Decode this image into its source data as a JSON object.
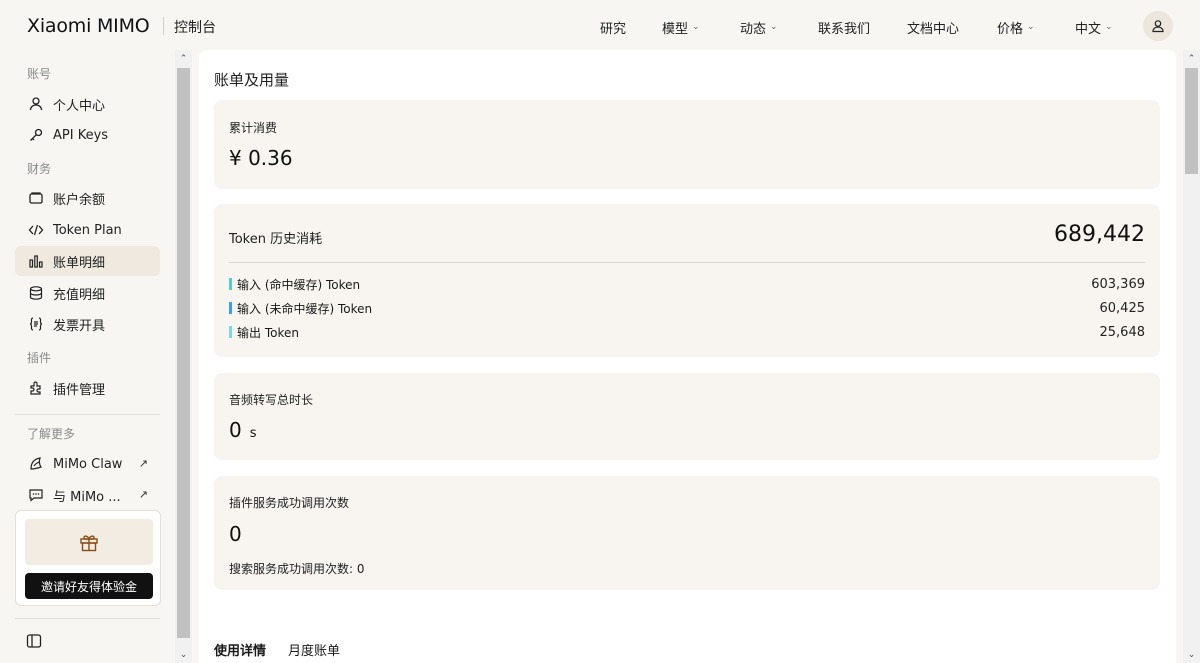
{
  "header": {
    "brand": "Xiaomi MIMO",
    "console_label": "控制台",
    "nav": [
      {
        "label": "研究",
        "has_dropdown": false
      },
      {
        "label": "模型",
        "has_dropdown": true
      },
      {
        "label": "动态",
        "has_dropdown": true
      },
      {
        "label": "联系我们",
        "has_dropdown": false
      },
      {
        "label": "文档中心",
        "has_dropdown": false
      },
      {
        "label": "价格",
        "has_dropdown": true
      },
      {
        "label": "中文",
        "has_dropdown": true
      }
    ],
    "avatar_icon": "user-icon"
  },
  "sidebar": {
    "sections": [
      {
        "title": "账号"
      },
      {
        "title": "财务"
      },
      {
        "title": "插件"
      },
      {
        "title": "了解更多"
      }
    ],
    "items": [
      {
        "label": "个人中心",
        "icon": "user-icon"
      },
      {
        "label": "API Keys",
        "icon": "key-icon"
      },
      {
        "label": "账户余额",
        "icon": "wallet-icon"
      },
      {
        "label": "Token Plan",
        "icon": "code-icon"
      },
      {
        "label": "账单明细",
        "icon": "bar-chart-icon",
        "active": true
      },
      {
        "label": "充值明细",
        "icon": "database-icon"
      },
      {
        "label": "发票开具",
        "icon": "invoice-icon"
      },
      {
        "label": "插件管理",
        "icon": "plugin-icon"
      },
      {
        "label": "MiMo Claw",
        "icon": "claw-icon",
        "external": true
      },
      {
        "label": "与 MiMo ...",
        "icon": "chat-icon",
        "external": true
      }
    ],
    "invite_button": "邀请好友得体验金"
  },
  "main": {
    "title": "账单及用量",
    "total_spend": {
      "label": "累计消费",
      "value": "¥ 0.36"
    },
    "token_history": {
      "label": "Token 历史消耗",
      "total": "689,442",
      "rows": [
        {
          "label": "输入 (命中缓存) Token",
          "value": "603,369",
          "color": "#4fd1c5"
        },
        {
          "label": "输入 (未命中缓存) Token",
          "value": "60,425",
          "color": "#3b9ef5"
        },
        {
          "label": "输出 Token",
          "value": "25,648",
          "color": "#7dd8e0"
        }
      ]
    },
    "audio": {
      "label": "音频转写总时长",
      "value": "0",
      "unit": "s"
    },
    "plugin": {
      "label": "插件服务成功调用次数",
      "value": "0",
      "search_label": "搜索服务成功调用次数: 0"
    },
    "tabs": [
      {
        "label": "使用详情",
        "active": true
      },
      {
        "label": "月度账单",
        "active": false
      }
    ]
  }
}
